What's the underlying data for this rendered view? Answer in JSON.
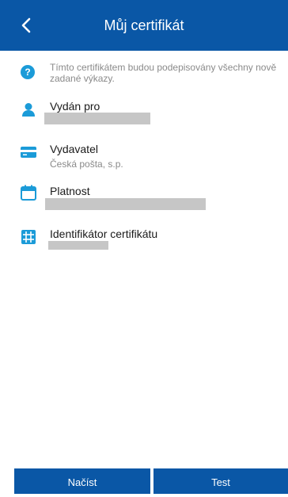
{
  "header": {
    "title": "Můj certifikát",
    "back_icon": "chevron-left-icon"
  },
  "info": {
    "icon": "question-circle-icon",
    "text": "Tímto certifikátem budou podepisovány všechny nově zadané výkazy."
  },
  "fields": [
    {
      "icon": "person-icon",
      "label": "Vydán pro",
      "value": ""
    },
    {
      "icon": "card-icon",
      "label": "Vydavatel",
      "value": "Česká pošta, s.p."
    },
    {
      "icon": "calendar-icon",
      "label": "Platnost",
      "value": ""
    },
    {
      "icon": "grid-icon",
      "label": "Identifikátor certifikátu",
      "value": ""
    }
  ],
  "footer": {
    "load_label": "Načíst",
    "test_label": "Test"
  },
  "colors": {
    "primary": "#0a57a6",
    "accent": "#1b9bd8",
    "redacted": "#c6c6c6"
  }
}
